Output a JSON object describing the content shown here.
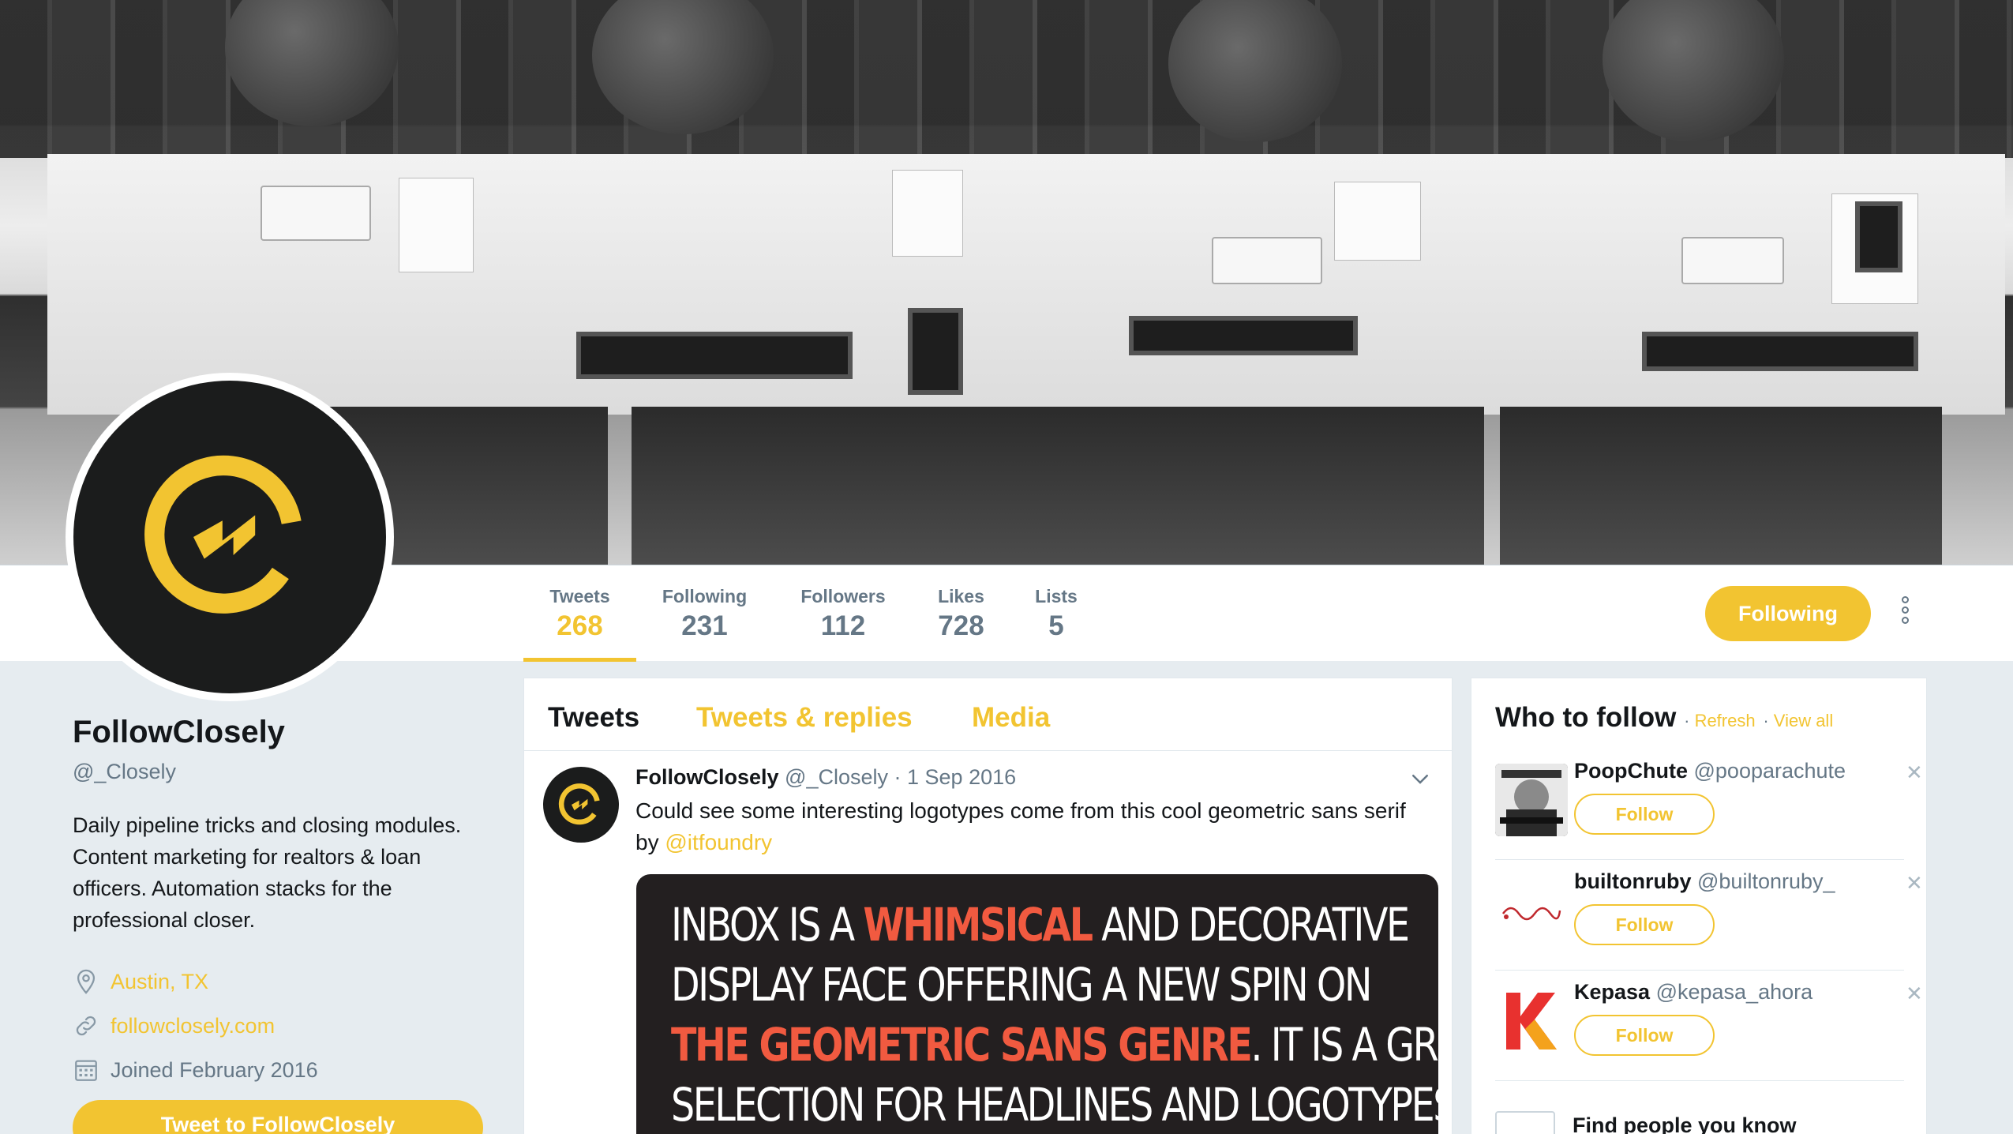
{
  "profile": {
    "name": "FollowClosely",
    "handle": "@_Closely",
    "bio": "Daily pipeline tricks and closing modules. Content marketing for realtors & loan officers. Automation stacks for the professional closer.",
    "location": "Austin, TX",
    "website": "followclosely.com",
    "joined": "Joined February 2016",
    "tweet_to_label": "Tweet to FollowClosely"
  },
  "stats": [
    {
      "label": "Tweets",
      "value": "268"
    },
    {
      "label": "Following",
      "value": "231"
    },
    {
      "label": "Followers",
      "value": "112"
    },
    {
      "label": "Likes",
      "value": "728"
    },
    {
      "label": "Lists",
      "value": "5"
    }
  ],
  "nav": {
    "following_button": "Following"
  },
  "timeline": {
    "tabs": [
      "Tweets",
      "Tweets & replies",
      "Media"
    ],
    "tweet": {
      "name": "FollowClosely",
      "handle": "@_Closely",
      "date": "· 1 Sep 2016",
      "text": "Could see some interesting logotypes come from this cool geometric sans serif by ",
      "mention": "@itfoundry",
      "media_lines": [
        [
          "INBOX IS A ",
          "WHIMSICAL",
          " AND DECORATIVE"
        ],
        [
          "DISPLAY FACE OFFERING A NEW SPIN ON",
          "",
          ""
        ],
        [
          "",
          "THE GEOMETRIC SANS GENRE",
          ". IT IS A GREAT"
        ],
        [
          "SELECTION FOR HEADLINES AND LOGOTYPES",
          "",
          ""
        ]
      ]
    }
  },
  "who_to_follow": {
    "title": "Who to follow",
    "refresh": "Refresh",
    "view_all": "View all",
    "follow_label": "Follow",
    "suggestions": [
      {
        "name": "PoopChute",
        "handle": "@pooparachute"
      },
      {
        "name": "builtonruby",
        "handle": "@builtonruby_"
      },
      {
        "name": "Kepasa",
        "handle": "@kepasa_ahora"
      }
    ],
    "find_people": "Find people you know"
  },
  "colors": {
    "accent": "#f2c431",
    "text_secondary": "#657786",
    "background": "#e6ecf0"
  }
}
